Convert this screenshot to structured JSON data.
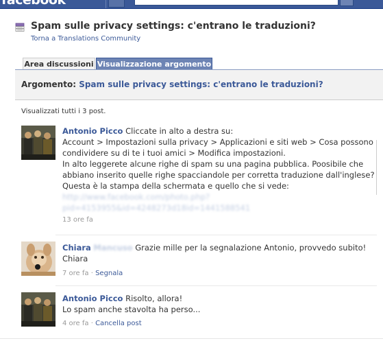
{
  "topbar": {
    "logo_text": "facebook",
    "bg_color": "#3b5998"
  },
  "header": {
    "icon": "discussion-topic-icon",
    "title": "Spam sulle privacy settings: c'entrano le traduzioni?",
    "back_link": "Torna a Translations Community"
  },
  "tabs": [
    {
      "label": "Area discussioni",
      "active": false
    },
    {
      "label": "Visualizzazione argomento",
      "active": true
    }
  ],
  "topic": {
    "label": "Argomento:",
    "title": "Spam sulle privacy settings: c'entrano le traduzioni?"
  },
  "post_count_text": "Visualizzati tutti i 3 post.",
  "posts": [
    {
      "author": "Antonio Picco",
      "lines": [
        "Cliccate in alto a destra su:",
        "Account > Impostazioni sulla privacy > Applicazioni e siti web > Cosa possono",
        "condividere su di te i tuoi amici > Modifica impostazioni.",
        "In alto leggerete alcune righe di spam su una pagina pubblica. Poosibile che",
        "abbiano inserito quelle righe spacciandole per corretta traduzione dall'inglese?",
        "Questa è la stampa della schermata e quello che si vede:"
      ],
      "link_line1": "http://www.facebook.com/photo.php?",
      "link_line2": "pid=4153955&id=4248273d18id=1441588541",
      "time": "13 ore fa"
    },
    {
      "author": "Chiara",
      "author_blurred": "Mancuso",
      "lines": [
        "Grazie mille per la segnalazione Antonio, provvedo subito!",
        "Chiara"
      ],
      "time": "7 ore fa",
      "action": "Segnala"
    },
    {
      "author": "Antonio Picco",
      "lines": [
        "Risolto, allora!",
        "Lo spam anche stavolta ha perso..."
      ],
      "time": "4 ore fa",
      "action": "Cancella post"
    }
  ]
}
